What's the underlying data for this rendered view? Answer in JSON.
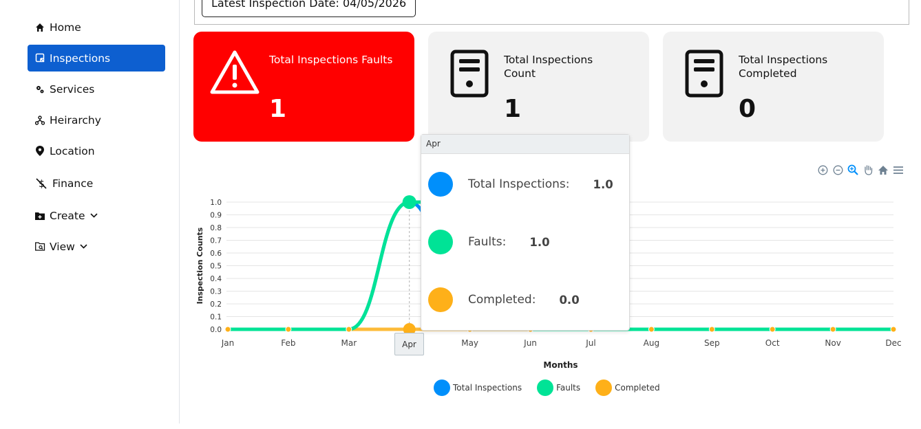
{
  "sidebar": {
    "items": [
      {
        "label": "Home",
        "icon": "home-icon"
      },
      {
        "label": "Inspections",
        "icon": "inspection-icon",
        "active": true
      },
      {
        "label": "Services",
        "icon": "gears-icon"
      },
      {
        "label": "Heirarchy",
        "icon": "hierarchy-icon"
      },
      {
        "label": "Location",
        "icon": "map-pin-icon"
      },
      {
        "label": "Finance",
        "icon": "dollar-slash-icon"
      },
      {
        "label": "Create",
        "icon": "folder-plus-icon",
        "dropdown": true
      },
      {
        "label": "View",
        "icon": "folder-search-icon",
        "dropdown": true
      }
    ],
    "accent": "#0d5fd0"
  },
  "header": {
    "latest_date": "Latest Inspection Date: 04/05/2026"
  },
  "cards": [
    {
      "title": "Total Inspections Faults",
      "value": "1",
      "color": "#ff0000",
      "icon": "warning-triangle-icon"
    },
    {
      "title": "Total Inspections Count",
      "value": "1",
      "color": "#f2f2f2",
      "icon": "document-icon"
    },
    {
      "title": "Total Inspections Completed",
      "value": "0",
      "color": "#f2f2f2",
      "icon": "document-icon"
    }
  ],
  "tooltip": {
    "header": "Apr",
    "rows": [
      {
        "label": "Total Inspections:",
        "value": "1.0",
        "color": "#008ffb"
      },
      {
        "label": "Faults:",
        "value": "1.0",
        "color": "#00e396"
      },
      {
        "label": "Completed:",
        "value": "0.0",
        "color": "#feb019"
      }
    ],
    "x_label": "Apr"
  },
  "chart_data": {
    "type": "line",
    "categories": [
      "Jan",
      "Feb",
      "Mar",
      "Apr",
      "May",
      "Jun",
      "Jul",
      "Aug",
      "Sep",
      "Oct",
      "Nov",
      "Dec"
    ],
    "series": [
      {
        "name": "Total Inspections",
        "values": [
          0,
          0,
          0,
          1,
          0,
          0,
          0,
          0,
          0,
          0,
          0,
          0
        ],
        "color": "#008ffb"
      },
      {
        "name": "Faults",
        "values": [
          0,
          0,
          0,
          1,
          1,
          0,
          0,
          0,
          0,
          0,
          0,
          0
        ],
        "color": "#00e396"
      },
      {
        "name": "Completed",
        "values": [
          0,
          0,
          0,
          0,
          0,
          0,
          0,
          0,
          0,
          0,
          0,
          0
        ],
        "color": "#feb019"
      }
    ],
    "title": "",
    "xlabel": "Months",
    "ylabel": "Inspection Counts",
    "ylim": [
      0,
      1
    ],
    "yticks": [
      "0.0",
      "0.1",
      "0.2",
      "0.3",
      "0.4",
      "0.5",
      "0.6",
      "0.7",
      "0.8",
      "0.9",
      "1.0"
    ],
    "grid": true,
    "legend": "bottom"
  },
  "toolbar": {
    "icons": [
      "zoom-in-icon",
      "zoom-out-icon",
      "zoom-select-icon",
      "pan-icon",
      "reset-home-icon",
      "menu-icon"
    ]
  }
}
